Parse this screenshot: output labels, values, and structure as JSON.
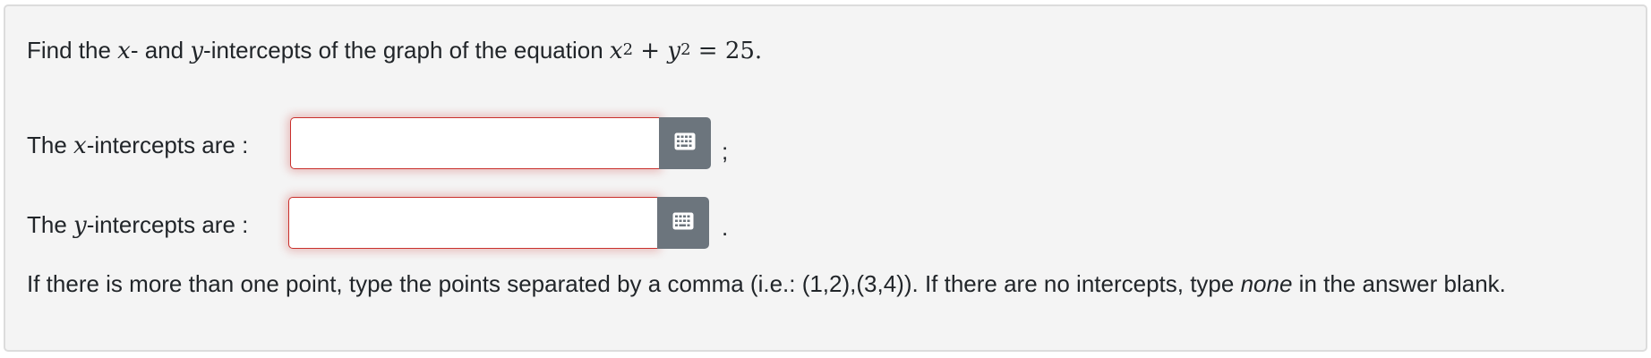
{
  "question": {
    "prefix": "Find the ",
    "var_x": "x",
    "mid1": "- and ",
    "var_y": "y",
    "mid2": "-intercepts of the graph of the equation ",
    "eq_x": "x",
    "eq_exp1": "2",
    "eq_plus": " + ",
    "eq_y": "y",
    "eq_exp2": "2",
    "eq_rhs": " = 25."
  },
  "x_intercepts": {
    "label_prefix": "The ",
    "label_var": "x",
    "label_suffix": "-intercepts are :",
    "value": "",
    "keyboard_icon": "keyboard-icon",
    "trailing": ";"
  },
  "y_intercepts": {
    "label_prefix": "The ",
    "label_var": "y",
    "label_suffix": "-intercepts are :",
    "value": "",
    "keyboard_icon": "keyboard-icon",
    "trailing": "."
  },
  "instructions": {
    "before": "If there is more than one point, type the points separated by a comma (i.e.: (1,2),(3,4)). If there are no intercepts, type ",
    "emphasis": "none",
    "after": " in the answer blank."
  },
  "colors": {
    "card_background": "#f4f4f4",
    "input_error_border": "#c9302c",
    "button_background": "#6c757d"
  }
}
